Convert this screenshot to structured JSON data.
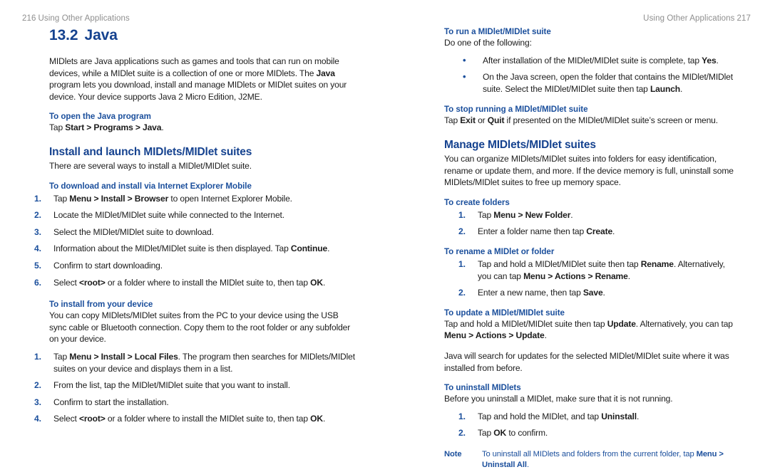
{
  "running_head": {
    "left_page_number": "216",
    "left_title": "Using Other Applications",
    "right_title": "Using Other Applications",
    "right_page_number": "217"
  },
  "colors": {
    "heading_blue": "#15428f",
    "task_blue": "#1b4f9c",
    "runhead_gray": "#8e8e8e",
    "body_black": "#1c1c1c"
  },
  "left_column": {
    "chapter": {
      "number": "13.2",
      "title": "Java"
    },
    "intro": {
      "part1": "MIDlets are Java applications such as games and tools that can run on mobile devices, while a MIDlet suite is a collection of one or more MIDlets. The ",
      "bold1": "Java",
      "part2": " program lets you download, install and manage MIDlets or MIDlet suites on your device. Your device supports Java 2 Micro Edition, J2ME."
    },
    "task_open": {
      "heading": "To open the Java program",
      "line_pre": "Tap ",
      "line_bold": "Start > Programs > Java",
      "line_post": "."
    },
    "section_install": {
      "heading": "Install and launch MIDlets/MIDlet suites",
      "intro": "There are several ways to install a MIDlet/MIDlet suite."
    },
    "task_download": {
      "heading": "To download and install via Internet Explorer Mobile",
      "steps": [
        {
          "n": "1.",
          "pre": "Tap ",
          "bold": "Menu > Install > Browser",
          "post": " to open Internet Explorer Mobile."
        },
        {
          "n": "2.",
          "pre": "Locate the MIDlet/MIDlet suite while connected to the Internet.",
          "bold": "",
          "post": ""
        },
        {
          "n": "3.",
          "pre": "Select the MIDlet/MIDlet suite to download.",
          "bold": "",
          "post": ""
        },
        {
          "n": "4.",
          "pre": "Information about the MIDlet/MIDlet suite is then displayed. Tap ",
          "bold": "Continue",
          "post": "."
        },
        {
          "n": "5.",
          "pre": "Confirm to start downloading.",
          "bold": "",
          "post": ""
        },
        {
          "n": "6.",
          "pre": "Select ",
          "bold": "<root>",
          "post": " or a folder where to install the MIDlet suite to, then tap ",
          "bold2": "OK",
          "post2": "."
        }
      ]
    },
    "task_install_device": {
      "heading": "To install from your device",
      "intro": "You can copy MIDlets/MIDlet suites from the PC to your device using the USB sync cable or Bluetooth connection. Copy them to the root folder or any subfolder on your device.",
      "steps": [
        {
          "n": "1.",
          "pre": "Tap ",
          "bold": "Menu > Install > Local Files",
          "post": ". The program then searches for MIDlets/MIDlet suites on your device and displays them in a list."
        },
        {
          "n": "2.",
          "pre": "From the list, tap the MIDlet/MIDlet suite that you want to install.",
          "bold": "",
          "post": ""
        },
        {
          "n": "3.",
          "pre": "Confirm to start the installation.",
          "bold": "",
          "post": ""
        },
        {
          "n": "4.",
          "pre": "Select ",
          "bold": "<root>",
          "post": " or a folder where to install the MIDlet suite to, then tap ",
          "bold2": "OK",
          "post2": "."
        }
      ]
    }
  },
  "right_column": {
    "task_run": {
      "heading": "To run a MIDlet/MIDlet suite",
      "intro": "Do one of the following:",
      "bullets": [
        {
          "marker": "•",
          "pre": "After installation of the MIDlet/MIDlet suite is complete, tap ",
          "bold": "Yes",
          "post": "."
        },
        {
          "marker": "•",
          "pre": "On the Java screen, open the folder that contains the MIDlet/MIDlet suite. Select the MIDlet/MIDlet suite then tap ",
          "bold": "Launch",
          "post": "."
        }
      ]
    },
    "task_stop": {
      "heading": "To stop running a MIDlet/MIDlet suite",
      "pre": "Tap ",
      "bold1": "Exit",
      "mid": " or ",
      "bold2": "Quit",
      "post": " if presented on the MIDlet/MIDlet suite’s screen or menu."
    },
    "section_manage": {
      "heading": "Manage MIDlets/MIDlet suites",
      "intro": "You can organize MIDlets/MIDlet suites into folders for easy identification, rename or update them, and more. If the device memory is full, uninstall some MIDlets/MIDlet suites to free up memory space."
    },
    "task_create_folders": {
      "heading": "To create folders",
      "steps": [
        {
          "n": "1.",
          "pre": "Tap ",
          "bold": "Menu > New Folder",
          "post": "."
        },
        {
          "n": "2.",
          "pre": "Enter a folder name then tap ",
          "bold": "Create",
          "post": "."
        }
      ]
    },
    "task_rename": {
      "heading": "To rename a MIDlet or folder",
      "steps": [
        {
          "n": "1.",
          "pre": "Tap and hold a MIDlet/MIDlet suite then tap ",
          "bold": "Rename",
          "post": ". Alternatively, you can tap ",
          "bold2": "Menu > Actions > Rename",
          "post2": "."
        },
        {
          "n": "2.",
          "pre": "Enter a new name, then tap ",
          "bold": "Save",
          "post": "."
        }
      ]
    },
    "task_update": {
      "heading": "To update a MIDlet/MIDlet suite",
      "pre": "Tap and hold a MIDlet/MIDlet suite then tap ",
      "bold1": "Update",
      "mid": ". Alternatively, you can tap ",
      "bold2": "Menu > Actions > Update",
      "post": ".",
      "para2": "Java will search for updates for the selected MIDlet/MIDlet suite where it was installed from before."
    },
    "task_uninstall": {
      "heading": "To uninstall MIDlets",
      "intro": "Before you uninstall a MIDlet, make sure that it is not running.",
      "steps": [
        {
          "n": "1.",
          "pre": "Tap and hold the MIDlet, and tap ",
          "bold": "Uninstall",
          "post": "."
        },
        {
          "n": "2.",
          "pre": "Tap ",
          "bold": "OK",
          "post": " to confirm."
        }
      ]
    },
    "note": {
      "label": "Note",
      "pre": "To uninstall all MIDlets and folders from the current folder, tap ",
      "bold": "Menu > Uninstall All",
      "post": "."
    }
  }
}
